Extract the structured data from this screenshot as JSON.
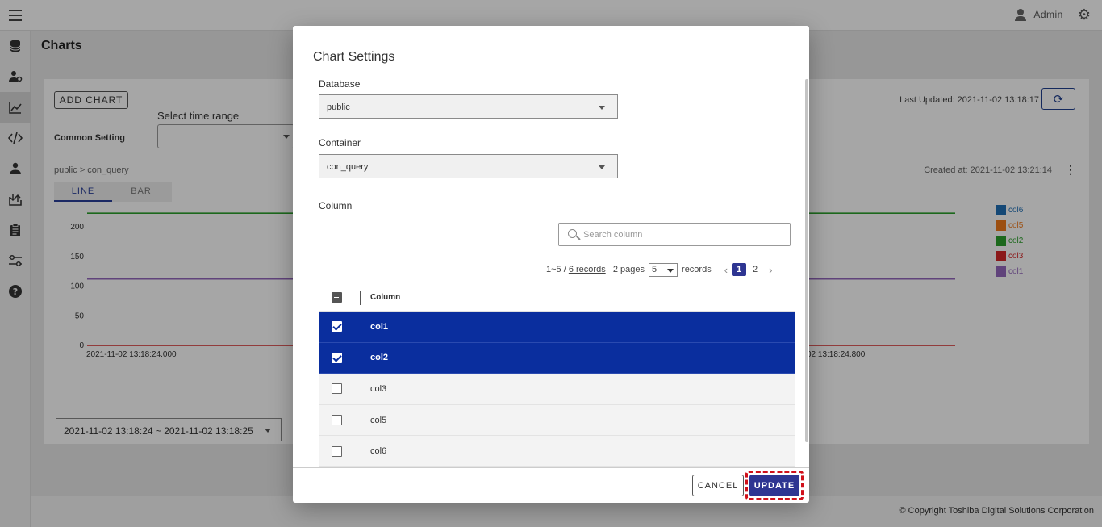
{
  "header": {
    "user_name": "Admin"
  },
  "page": {
    "title": "Charts",
    "add_chart_label": "ADD CHART",
    "common_setting_label": "Common Setting",
    "time_range_label": "Select time range",
    "last_updated": "Last Updated: 2021-11-02 13:18:17",
    "breadcrumb": [
      "public",
      "con_query"
    ],
    "created_at": "Created at: 2021-11-02 13:21:14",
    "tabs": [
      "LINE",
      "BAR"
    ],
    "active_tab": "LINE",
    "range_value": "2021-11-02 13:18:24 ~ 2021-11-02 13:18:25"
  },
  "chart_data": {
    "type": "line",
    "y_ticks": [
      "0",
      "50",
      "100",
      "150",
      "200"
    ],
    "ylim": [
      0,
      230
    ],
    "x_tick_labels": [
      "2021-11-02 13:18:24.000",
      "02 13:18:24.800"
    ],
    "series": [
      {
        "name": "col6",
        "color": "#1f6fb5",
        "value": null
      },
      {
        "name": "col5",
        "color": "#f07a1b",
        "value": null
      },
      {
        "name": "col2",
        "color": "#2ca02c",
        "value": 223
      },
      {
        "name": "col3",
        "color": "#d62728",
        "value": 0
      },
      {
        "name": "col1",
        "color": "#9467bd",
        "value": 112
      }
    ]
  },
  "footer": {
    "copyright": "© Copyright Toshiba Digital Solutions Corporation"
  },
  "dialog": {
    "title": "Chart Settings",
    "database_label": "Database",
    "database_value": "public",
    "container_label": "Container",
    "container_value": "con_query",
    "column_label": "Column",
    "search_placeholder": "Search column",
    "pagination": {
      "range": "1~5 /",
      "records_link": "6 records",
      "pages": "2 pages",
      "page_size": "5",
      "records_word": "records",
      "pages_list": [
        "1",
        "2"
      ],
      "current_page": "1"
    },
    "table_header": "Column",
    "rows": [
      {
        "name": "col1",
        "checked": true
      },
      {
        "name": "col2",
        "checked": true
      },
      {
        "name": "col3",
        "checked": false
      },
      {
        "name": "col5",
        "checked": false
      },
      {
        "name": "col6",
        "checked": false
      }
    ],
    "cancel_label": "CANCEL",
    "update_label": "UPDATE"
  },
  "colors": {
    "primary": "#2e3592",
    "selected_row": "#0a2e9e",
    "highlight": "#d0101a"
  }
}
